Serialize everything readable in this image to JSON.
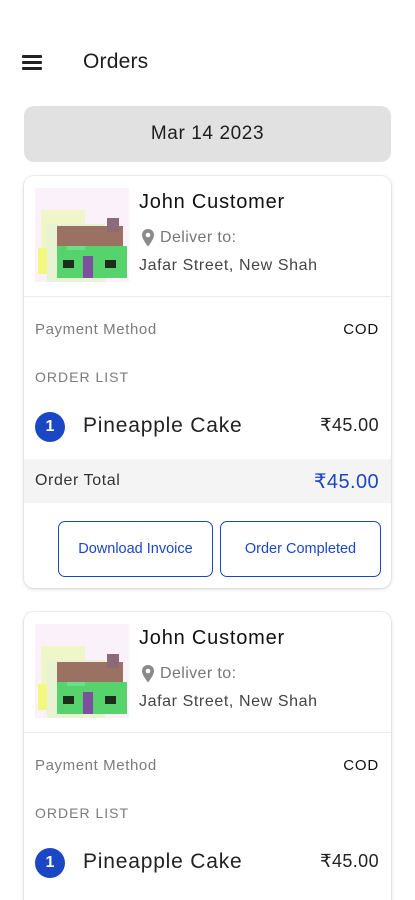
{
  "header": {
    "title": "Orders"
  },
  "date_label": "Mar 14 2023",
  "labels": {
    "deliver_to": "Deliver to:",
    "payment_method": "Payment Method",
    "order_list": "ORDER LIST",
    "order_total": "Order Total"
  },
  "buttons": {
    "download_invoice": "Download Invoice",
    "order_completed": "Order Completed"
  },
  "orders": [
    {
      "customer_name": "John Customer",
      "address": "Jafar Street, New Shah",
      "payment_method": "COD",
      "items": [
        {
          "qty": "1",
          "name": "Pineapple Cake",
          "price": "₹45.00"
        }
      ],
      "total": "₹45.00"
    },
    {
      "customer_name": "John Customer",
      "address": "Jafar Street, New Shah",
      "payment_method": "COD",
      "items": [
        {
          "qty": "1",
          "name": "Pineapple Cake",
          "price": "₹45.00"
        }
      ]
    }
  ],
  "colors": {
    "accent": "#1b47c4",
    "date_pill": "#e1e1e1",
    "total_row": "#f4f4f4"
  },
  "icons": {
    "menu": "menu-icon",
    "location": "location-pin-icon",
    "avatar": "pixel-house-avatar"
  }
}
